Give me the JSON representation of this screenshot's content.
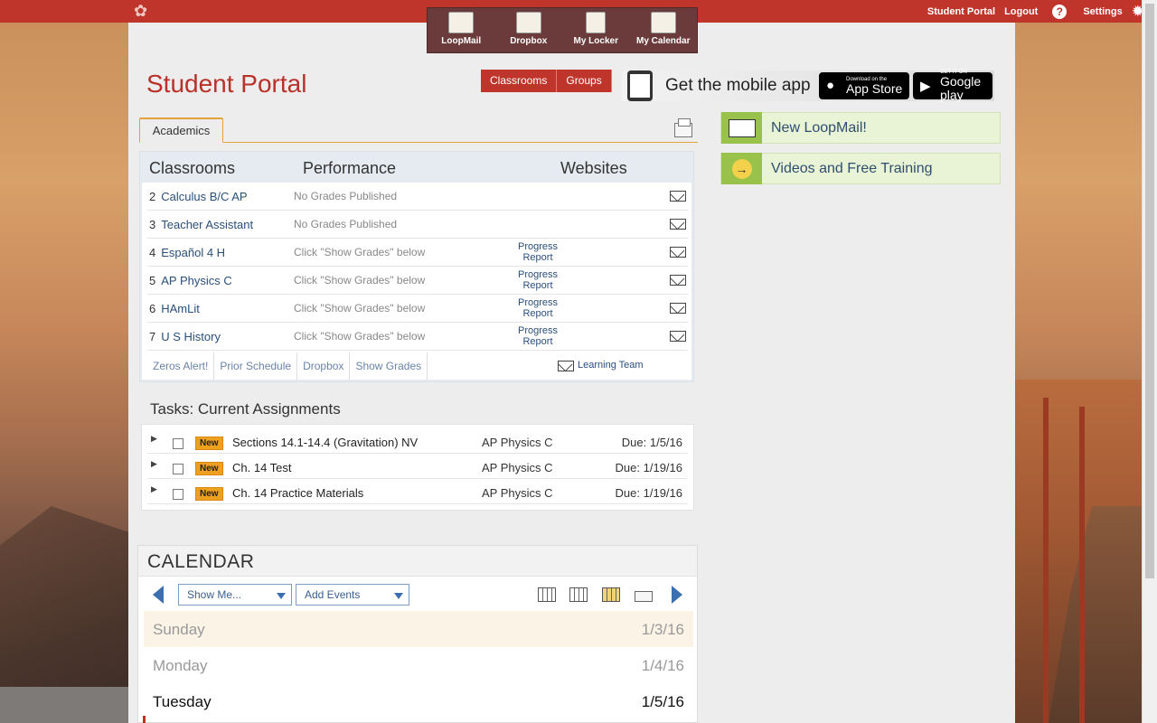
{
  "topbar": {
    "links": [
      "Student Portal",
      "Logout"
    ],
    "help_label": "?",
    "settings_label": "Settings"
  },
  "quick_launch": [
    "LoopMail",
    "Dropbox",
    "My Locker",
    "My Calendar"
  ],
  "header": {
    "title": "Student Portal",
    "segments": [
      "Classrooms",
      "Groups"
    ],
    "app_banner": {
      "text": "Get the mobile app",
      "apple_small": "Download on the",
      "apple_big": "App Store",
      "google_small": "GET IT ON",
      "google_big": "Google play"
    }
  },
  "tabs": {
    "active": "Academics"
  },
  "academics": {
    "headers": [
      "Classrooms",
      "Performance",
      "Websites"
    ],
    "rows": [
      {
        "period": "2",
        "name": "Calculus B/C AP",
        "perf": "No Grades Published",
        "progress": ""
      },
      {
        "period": "3",
        "name": "Teacher Assistant",
        "perf": "No Grades Published",
        "progress": ""
      },
      {
        "period": "4",
        "name": "Español 4 H",
        "perf": "Click \"Show Grades\" below",
        "progress": "Progress Report"
      },
      {
        "period": "5",
        "name": "AP Physics C",
        "perf": "Click \"Show Grades\" below",
        "progress": "Progress Report"
      },
      {
        "period": "6",
        "name": "HAmLit",
        "perf": "Click \"Show Grades\" below",
        "progress": "Progress Report"
      },
      {
        "period": "7",
        "name": "U S History",
        "perf": "Click \"Show Grades\" below",
        "progress": "Progress Report"
      }
    ],
    "footer_links": [
      "Zeros Alert!",
      "Prior Schedule",
      "Dropbox",
      "Show Grades"
    ],
    "learning_team": "Learning Team"
  },
  "tasks": {
    "title": "Tasks: Current Assignments",
    "rows": [
      {
        "badge": "New",
        "name": "Sections 14.1-14.4 (Gravitation) NV",
        "class": "AP Physics C",
        "due": "Due:  1/5/16"
      },
      {
        "badge": "New",
        "name": "Ch. 14 Test",
        "class": "AP Physics C",
        "due": "Due:  1/19/16"
      },
      {
        "badge": "New",
        "name": "Ch. 14 Practice Materials",
        "class": "AP Physics C",
        "due": "Due:  1/19/16"
      }
    ]
  },
  "calendar": {
    "title": "CALENDAR",
    "show_me": "Show Me...",
    "add_events": "Add Events",
    "days": [
      {
        "name": "Sunday",
        "date": "1/3/16"
      },
      {
        "name": "Monday",
        "date": "1/4/16"
      },
      {
        "name": "Tuesday",
        "date": "1/5/16"
      }
    ]
  },
  "right_column": {
    "promos": [
      "New LoopMail!",
      "Videos and Free Training"
    ]
  },
  "colors": {
    "brand_red": "#c0352b",
    "link_blue": "#2a4f7a",
    "promo_green": "#98c24a",
    "badge_orange": "#f0a020"
  }
}
